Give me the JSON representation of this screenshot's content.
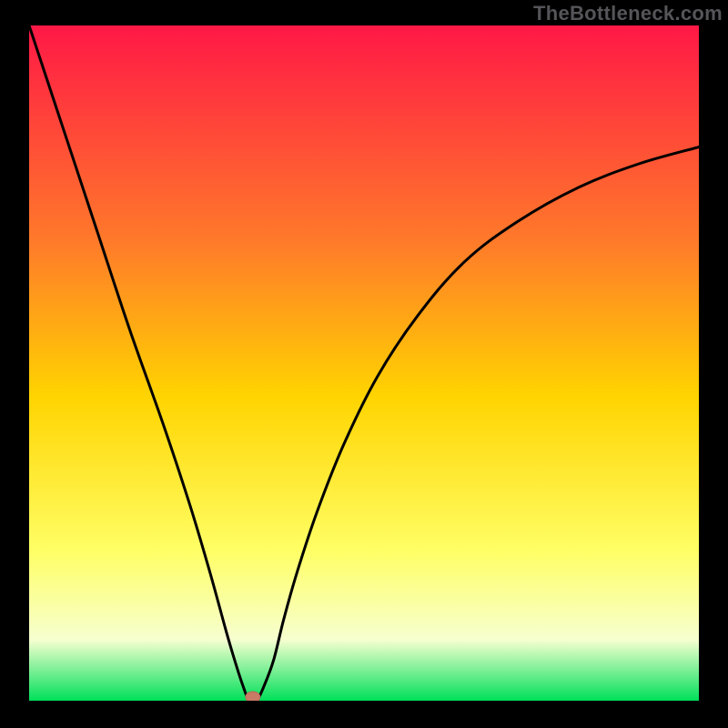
{
  "watermark": "TheBottleneck.com",
  "colors": {
    "frame": "#000000",
    "gradient_top": "#ff1846",
    "gradient_mid_upper": "#ff7a2a",
    "gradient_mid": "#ffd400",
    "gradient_mid_lower": "#ffff66",
    "gradient_low": "#f6ffd0",
    "gradient_bottom": "#00e05a",
    "curve": "#000000",
    "marker_fill": "#c97b66",
    "marker_stroke": "#b46a58"
  },
  "chart_data": {
    "type": "line",
    "title": "",
    "xlabel": "",
    "ylabel": "",
    "ylim": [
      0,
      100
    ],
    "x": [
      0,
      5,
      10,
      15,
      20,
      24,
      27,
      29.5,
      31,
      32,
      32.8,
      33.4,
      34,
      35,
      36.5,
      38,
      40,
      43,
      47,
      52,
      58,
      65,
      73,
      82,
      91,
      100
    ],
    "values": [
      100,
      85,
      70,
      55,
      41,
      29,
      19,
      10,
      5,
      2,
      0,
      0,
      0,
      2,
      6,
      12,
      19,
      28,
      38,
      48,
      57,
      65,
      71,
      76,
      79.5,
      82
    ],
    "marker": {
      "x": 33.4,
      "y": 0
    }
  }
}
